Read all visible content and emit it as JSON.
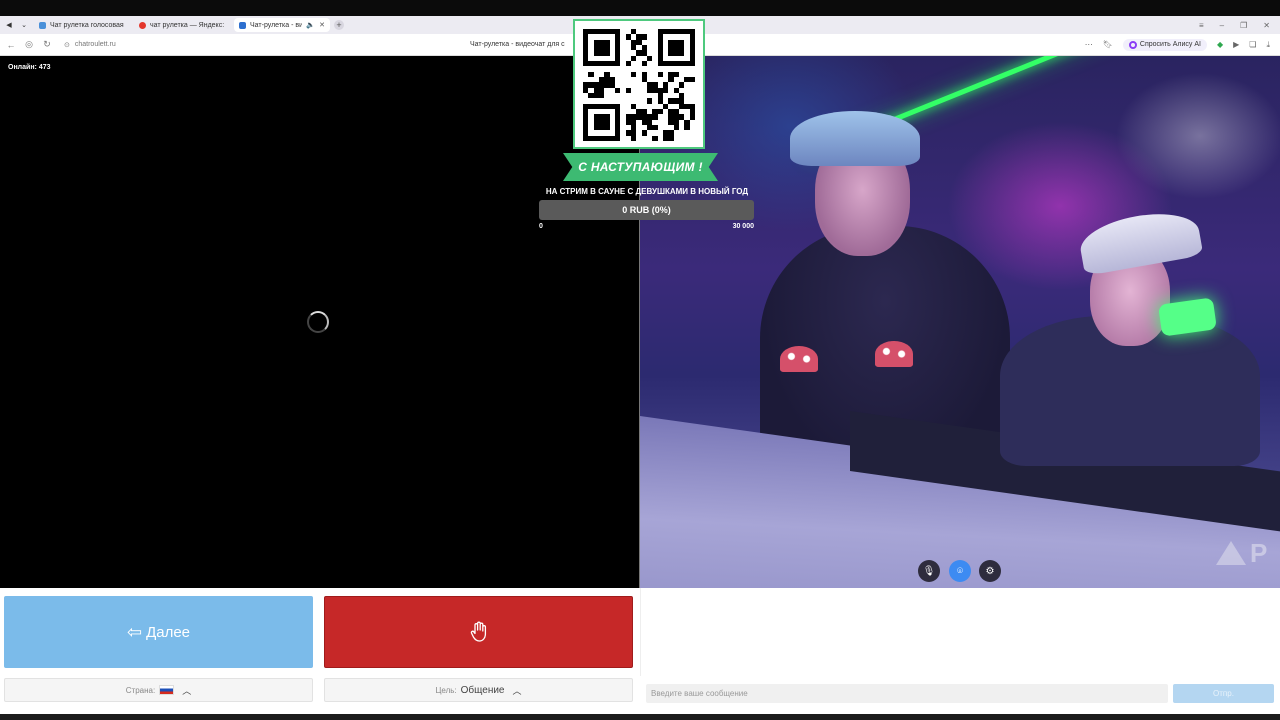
{
  "browser": {
    "tabs": [
      {
        "label": "Чат рулетка голосовая —",
        "favicon_color": "#4a90d9"
      },
      {
        "label": "чат рулетка — Яндекс: на",
        "favicon_color": "#e3362c"
      },
      {
        "label": "Чат-рулетка - видео",
        "favicon_color": "#2d6fcf",
        "active": true,
        "sound_icon": "speaker-icon"
      }
    ],
    "url": "chatroulett.ru",
    "page_title": "Чат-рулетка - видеочат для с",
    "alice_label": "Спросить Алису AI"
  },
  "left_video": {
    "online_label": "Онлайн: 473"
  },
  "overlay": {
    "banner": "С НАСТУПАЮЩИМ !",
    "stream_title": "НА СТРИМ В САУНЕ С ДЕВУШКАМИ В НОВЫЙ ГОД",
    "progress_text": "0 RUB (0%)",
    "progress_fraction": 0,
    "progress_min": "0",
    "progress_max": "30 000",
    "accent_color": "#3dba72"
  },
  "right_video": {
    "watermark": "P"
  },
  "controls": {
    "next_label": "Далее",
    "stop_icon": "hand-icon",
    "country_label": "Страна:",
    "goal_label": "Цель:",
    "goal_value": "Общение",
    "next_color": "#7bbbea",
    "stop_color": "#c62828"
  },
  "chat": {
    "placeholder": "Введите ваше сообщение",
    "send_label": "Отпр."
  }
}
